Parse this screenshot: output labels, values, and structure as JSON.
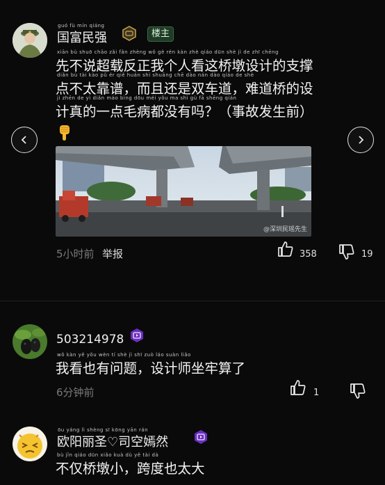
{
  "comments": [
    {
      "username": "国富民强",
      "username_pinyin": "guó  fù  mín qiáng",
      "owner_tag": "楼主",
      "lines": [
        {
          "text": "先不说超载反正我个人看这桥墩设计的支撑",
          "pinyin": "xiān   bù  shuō chāo  zǎi  fǎn zhèng  wǒ   gè    rén   kàn  zhè  qiáo  dūn  shè   jì    de   zhī  chēng"
        },
        {
          "text": "点不太靠谱，而且还是双车道，难道桥的设",
          "pinyin": "diǎn   bù   tài   kào   pǔ       ér    qiě  huán  shì shuāng chē  dào      nán   dào  qiáo   de    shè"
        },
        {
          "text": "计真的一点毛病都没有吗？（事故发生前）",
          "pinyin": "jì   zhēn  de    yì  diǎn máo bìng dōu méi  yǒu   ma          shì   gù    fā  shēng qián"
        }
      ],
      "emoji_icon": "point-down-hand-icon",
      "image_watermark": "@深圳民瑶先生",
      "time": "5小时前",
      "report_label": "举报",
      "likes": "358",
      "dislikes": "19"
    },
    {
      "username": "503214978",
      "lines": [
        {
          "text": "我看也有问题，设计师坐牢算了",
          "pinyin": "wǒ   kàn   yě   yǒu  wèn   tí        shè   jì    shī  zuò  láo  suàn  liǎo"
        }
      ],
      "time": "6分钟前",
      "likes": "1",
      "dislikes": ""
    },
    {
      "username": "欧阳丽圣♡司空嫣然",
      "username_pinyin": "ōu  yáng   lì   shèng      sī  kōng yān  rán",
      "lines": [
        {
          "text": "不仅桥墩小，跨度也太大",
          "pinyin": "bù   jǐn  qiáo  dūn  xiǎo       kuà   dù    yě   tài   dà"
        }
      ]
    }
  ],
  "colors": {
    "background": "#0a0a0a",
    "owner_tag_bg": "#1f3a26",
    "vip_badge": "#6a2fbf",
    "gold_badge": "#c9a646"
  }
}
